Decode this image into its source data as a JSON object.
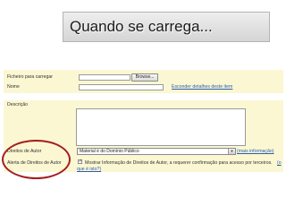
{
  "slide": {
    "title": "Quando se carrega..."
  },
  "form": {
    "file_label": "Ficheiro para carregar",
    "browse_label": "Browse...",
    "name_label": "Nome",
    "hide_details_link": "Esconder detalhes deste item",
    "description_label": "Descrição",
    "rights_label": "Direitos de Autor",
    "rights_selected": "Material é do Domínio Público",
    "more_info_link": "(mais informação)",
    "alert_label": "Alerta de Direitos de Autor",
    "alert_text": "Mostrar Informação de Direitos de Autor, a requerer confirmação para acesso por terceiros.",
    "alert_link_part1": "(o",
    "alert_link_part2": "que é isto?)"
  },
  "colors": {
    "highlight_yellow": "#fbf7d3",
    "annotation_circle": "#a31e1e",
    "link": "#2a5db0"
  },
  "icons": {
    "select_arrow": "chevron-down-icon"
  }
}
